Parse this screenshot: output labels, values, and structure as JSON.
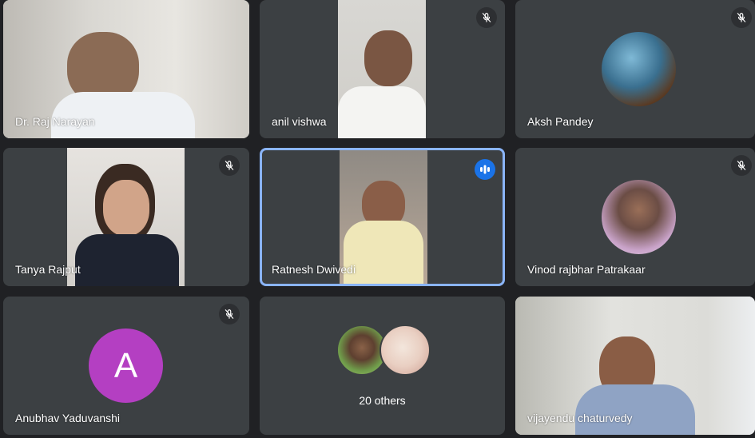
{
  "participants": [
    {
      "name": "Dr. Raj Narayan",
      "muted": false
    },
    {
      "name": "anil vishwa",
      "muted": true
    },
    {
      "name": "Aksh Pandey",
      "muted": true
    },
    {
      "name": "Tanya Rajput",
      "muted": true
    },
    {
      "name": "Ratnesh Dwivedi",
      "muted": false,
      "speaking": true
    },
    {
      "name": "Vinod rajbhar Patrakaar",
      "muted": true
    },
    {
      "name": "Anubhav Yaduvanshi",
      "muted": true,
      "initial": "A",
      "avatar_color": "#b43fc2"
    },
    {
      "name": "vijayendu chaturvedy",
      "muted": false
    }
  ],
  "others": {
    "label": "20 others"
  },
  "colors": {
    "background": "#202124",
    "tile": "#3c4043",
    "active_border": "#8ab4f8",
    "speaking_indicator": "#1a73e8"
  }
}
